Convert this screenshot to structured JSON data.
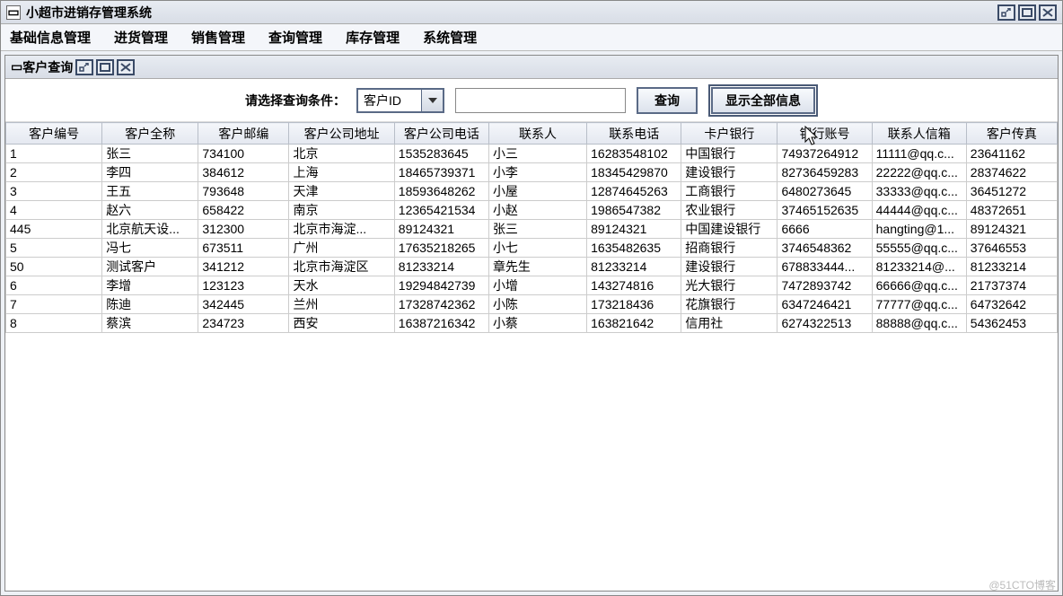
{
  "window": {
    "title": "小超市进销存管理系统"
  },
  "menubar": [
    "基础信息管理",
    "进货管理",
    "销售管理",
    "查询管理",
    "库存管理",
    "系统管理"
  ],
  "inner": {
    "title": "客户查询"
  },
  "search": {
    "label": "请选择查询条件：",
    "combo_value": "客户ID",
    "input_value": "",
    "btn_query": "查询",
    "btn_showall": "显示全部信息"
  },
  "table": {
    "headers": [
      "客户编号",
      "客户全称",
      "客户邮编",
      "客户公司地址",
      "客户公司电话",
      "联系人",
      "联系电话",
      "卡户银行",
      "银行账号",
      "联系人信箱",
      "客户传真"
    ],
    "rows": [
      [
        "1",
        "张三",
        "734100",
        "北京",
        "1535283645",
        "小三",
        "16283548102",
        "中国银行",
        "74937264912",
        "11111@qq.c...",
        "23641162"
      ],
      [
        "2",
        "李四",
        "384612",
        "上海",
        "18465739371",
        "小李",
        "18345429870",
        "建设银行",
        "82736459283",
        "22222@qq.c...",
        "28374622"
      ],
      [
        "3",
        "王五",
        "793648",
        "天津",
        "18593648262",
        "小屋",
        "12874645263",
        "工商银行",
        "6480273645",
        "33333@qq.c...",
        "36451272"
      ],
      [
        "4",
        "赵六",
        "658422",
        "南京",
        "12365421534",
        "小赵",
        "1986547382",
        "农业银行",
        "37465152635",
        "44444@qq.c...",
        "48372651"
      ],
      [
        "445",
        "北京航天设...",
        "312300",
        "北京市海淀...",
        "89124321",
        "张三",
        "89124321",
        "中国建设银行",
        "6666",
        "hangting@1...",
        "89124321"
      ],
      [
        "5",
        "冯七",
        "673511",
        "广州",
        "17635218265",
        "小七",
        "1635482635",
        "招商银行",
        "3746548362",
        "55555@qq.c...",
        "37646553"
      ],
      [
        "50",
        "测试客户",
        "341212",
        "北京市海淀区",
        "81233214",
        "章先生",
        "81233214",
        "建设银行",
        "678833444...",
        "81233214@...",
        "81233214"
      ],
      [
        "6",
        "李增",
        "123123",
        "天水",
        "19294842739",
        "小增",
        "143274816",
        "光大银行",
        "7472893742",
        "66666@qq.c...",
        "21737374"
      ],
      [
        "7",
        "陈迪",
        "342445",
        "兰州",
        "17328742362",
        "小陈",
        "173218436",
        "花旗银行",
        "6347246421",
        "77777@qq.c...",
        "64732642"
      ],
      [
        "8",
        "蔡滨",
        "234723",
        "西安",
        "16387216342",
        "小蔡",
        "163821642",
        "信用社",
        "6274322513",
        "88888@qq.c...",
        "54362453"
      ]
    ]
  },
  "watermark": "@51CTO博客"
}
